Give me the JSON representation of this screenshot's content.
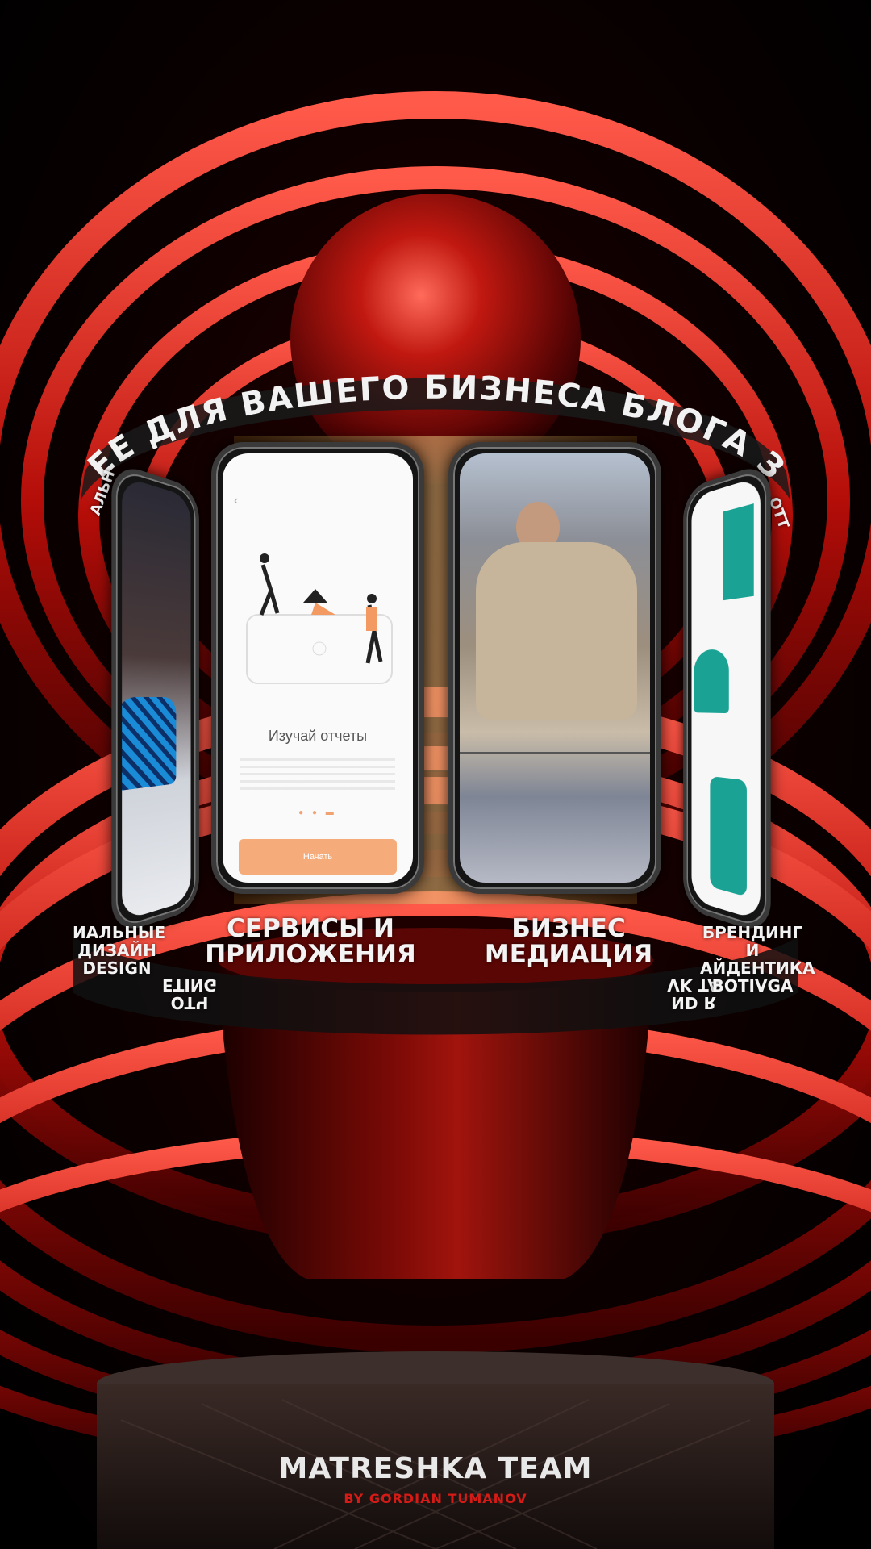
{
  "colors": {
    "accent": "#c4150f",
    "dark_red": "#4a0202",
    "screen_button": "#f6ac7a",
    "brand_text": "#e8e8e8",
    "brand_subtitle": "#d61a16"
  },
  "ring_top_text": "ЕЕ ДЛЯ ВАШЕГО БИЗНЕСА БЛОГА ЗАПУСКА",
  "ring_top_side_left": "АЛЬН",
  "ring_top_side_right": "ОТТ",
  "screens": {
    "onboarding": {
      "back_icon": "chevron-left-icon",
      "title": "Изучай отчеты",
      "button": "Начать",
      "dots": "● ● ▬"
    }
  },
  "ring_bottom": {
    "left_outer": [
      "ИАЛЬНЫЕ",
      "ДИЗАЙН",
      "DESIGN"
    ],
    "left_inner": [
      "ОТЧ",
      "ETING"
    ],
    "center_left": [
      "СЕРВИСЫ И",
      "ПРИЛОЖЕНИЯ"
    ],
    "center_right": [
      "БИЗНЕС",
      "МЕДИАЦИЯ"
    ],
    "right_inner": [
      "ND R",
      "VK TA"
    ],
    "right_outer": [
      "БРЕНДИНГ",
      "И АЙДЕНТИКА",
      "BOTIVGA"
    ]
  },
  "brand": {
    "title": "MATRESHKA TEAM",
    "subtitle": "BY GORDIAN TUMANOV"
  }
}
